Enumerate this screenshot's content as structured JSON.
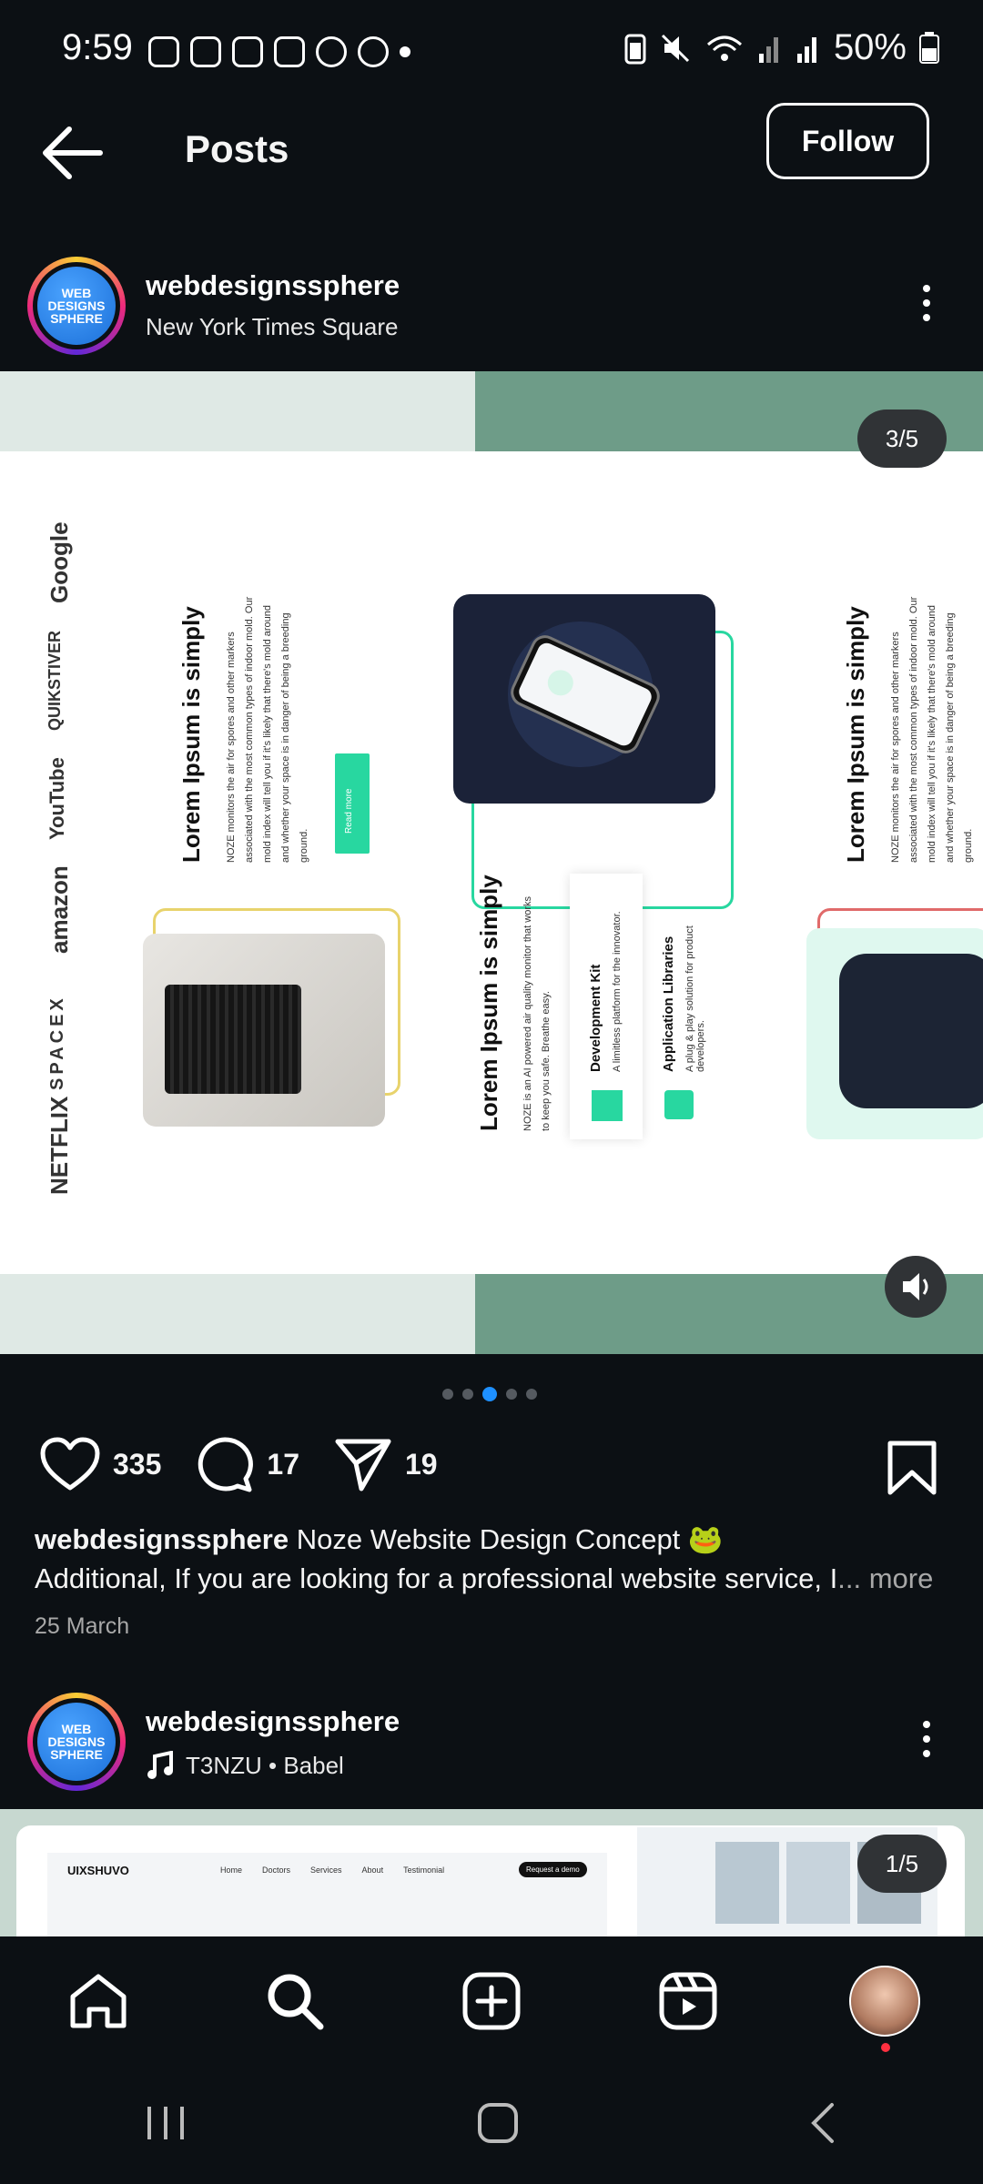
{
  "status_bar": {
    "time": "9:59",
    "notification_icons": [
      "facebook-icon",
      "instagram-icon",
      "gallery-icon",
      "instagram-icon",
      "messenger-icon",
      "whatsapp-icon"
    ],
    "battery": "50%"
  },
  "header": {
    "title": "Posts",
    "follow_label": "Follow"
  },
  "post1": {
    "username": "webdesignssphere",
    "location": "New York Times Square",
    "avatar_text": "WEB DESIGNS SPHERE",
    "slide_counter": "3/5",
    "slide": {
      "logos": [
        "Google",
        "QUIKSTIVER",
        "YouTube",
        "amazon",
        "SPACEX",
        "NETFLIX"
      ],
      "heading": "Lorem Ipsum is simply",
      "paragraph": "NOZE monitors the air for spores and other markers associated with the most common types of indoor mold. Our mold index will tell you if it's likely that there's mold around and whether your space is in danger of being a breeding ground.",
      "read_more": "Read more",
      "intro": "NOZE is an AI powered air quality monitor that works to keep you safe. Breathe easy.",
      "feature1_title": "Development Kit",
      "feature1_text": "A limitless platform for the innovator.",
      "feature2_title": "Application Libraries",
      "feature2_text": "A plug & play solution for product developers."
    },
    "likes": "335",
    "comments": "17",
    "shares": "19",
    "caption_user": "webdesignssphere",
    "caption_title": " Noze Website Design Concept 🐸",
    "caption_body": "Additional, If you are looking for a professional website service, I",
    "more": "... more",
    "date": "25 March"
  },
  "post2": {
    "username": "webdesignssphere",
    "audio": "T3NZU • Babel",
    "avatar_text": "WEB DESIGNS SPHERE",
    "slide_counter": "1/5",
    "site_logo": "UIXSHUVO",
    "site_nav": [
      "Home",
      "Doctors",
      "Services",
      "About",
      "Testimonial"
    ],
    "site_cta": "Request a demo"
  },
  "colors": {
    "background": "#0c1014",
    "accent_blue": "#1e90ff",
    "teal": "#28d7a0"
  }
}
